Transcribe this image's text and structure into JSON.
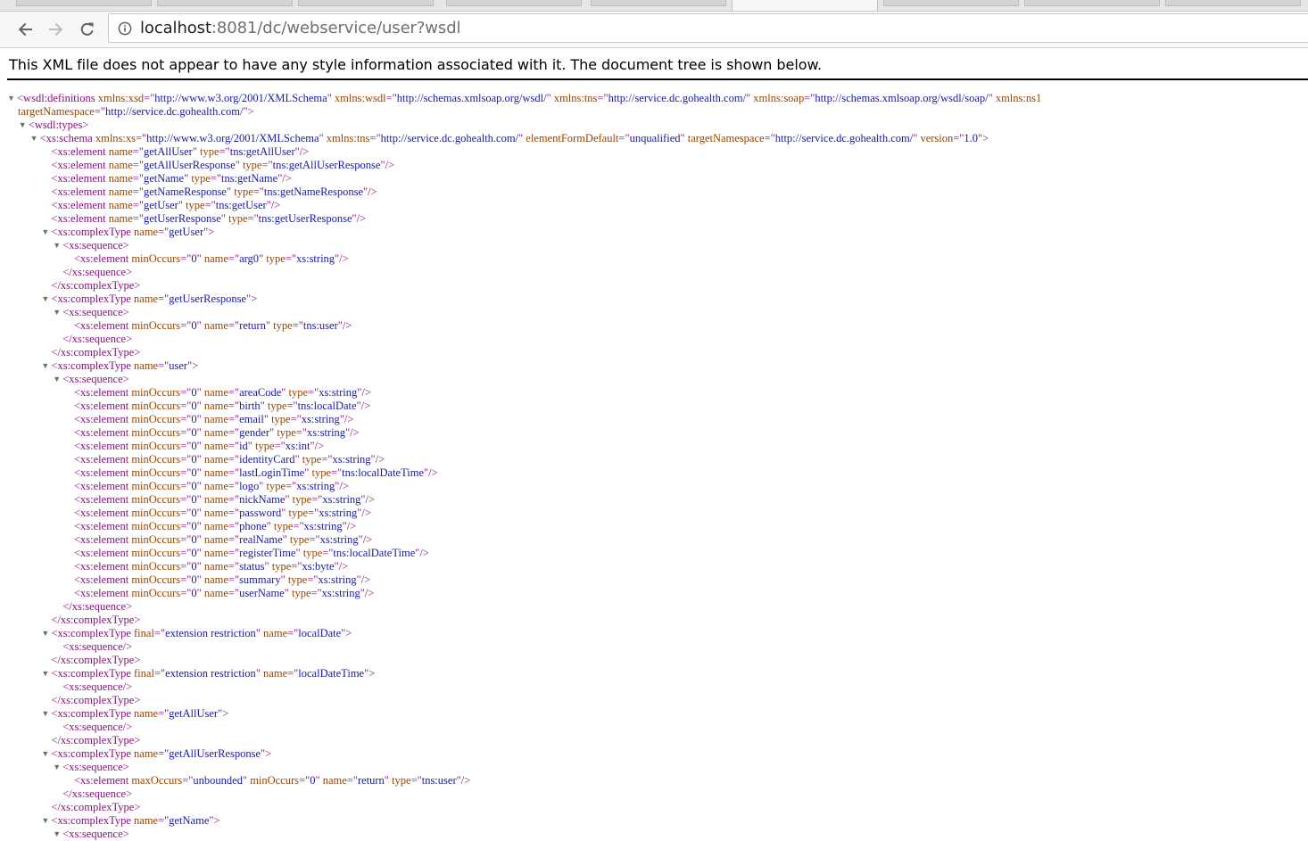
{
  "browser": {
    "address": {
      "host": "localhost",
      "rest": ":8081/dc/webservice/user?wsdl"
    },
    "icons": [
      "back-arrow-icon",
      "forward-arrow-icon",
      "reload-icon",
      "info-icon"
    ]
  },
  "notice": "This XML file does not appear to have any style information associated with it. The document tree is shown below.",
  "colors": {
    "tag": "#881280",
    "attr_name": "#994500",
    "attr_value": "#1a1aa6",
    "triangle": "#6e6e6e"
  },
  "xml_lines": [
    {
      "i": 0,
      "t": "open",
      "n": "wsdl:definitions",
      "a": [
        [
          "xmlns:xsd",
          "http://www.w3.org/2001/XMLSchema"
        ],
        [
          "xmlns:wsdl",
          "http://schemas.xmlsoap.org/wsdl/"
        ],
        [
          "xmlns:tns",
          "http://service.dc.gohealth.com/"
        ],
        [
          "xmlns:soap",
          "http://schemas.xmlsoap.org/wsdl/soap/"
        ]
      ],
      "extra": " xmlns:ns1",
      "tri": true
    },
    {
      "i": 0,
      "t": "raw",
      "a": [
        [
          "targetNamespace",
          "http://service.dc.gohealth.com/"
        ]
      ],
      "suffix": ">"
    },
    {
      "i": 1,
      "t": "open",
      "n": "wsdl:types",
      "a": [],
      "tri": true
    },
    {
      "i": 2,
      "t": "open",
      "n": "xs:schema",
      "a": [
        [
          "xmlns:xs",
          "http://www.w3.org/2001/XMLSchema"
        ],
        [
          "xmlns:tns",
          "http://service.dc.gohealth.com/"
        ],
        [
          "elementFormDefault",
          "unqualified"
        ],
        [
          "targetNamespace",
          "http://service.dc.gohealth.com/"
        ],
        [
          "version",
          "1.0"
        ]
      ],
      "tri": true
    },
    {
      "i": 3,
      "t": "self",
      "n": "xs:element",
      "a": [
        [
          "name",
          "getAllUser"
        ],
        [
          "type",
          "tns:getAllUser"
        ]
      ]
    },
    {
      "i": 3,
      "t": "self",
      "n": "xs:element",
      "a": [
        [
          "name",
          "getAllUserResponse"
        ],
        [
          "type",
          "tns:getAllUserResponse"
        ]
      ]
    },
    {
      "i": 3,
      "t": "self",
      "n": "xs:element",
      "a": [
        [
          "name",
          "getName"
        ],
        [
          "type",
          "tns:getName"
        ]
      ]
    },
    {
      "i": 3,
      "t": "self",
      "n": "xs:element",
      "a": [
        [
          "name",
          "getNameResponse"
        ],
        [
          "type",
          "tns:getNameResponse"
        ]
      ]
    },
    {
      "i": 3,
      "t": "self",
      "n": "xs:element",
      "a": [
        [
          "name",
          "getUser"
        ],
        [
          "type",
          "tns:getUser"
        ]
      ]
    },
    {
      "i": 3,
      "t": "self",
      "n": "xs:element",
      "a": [
        [
          "name",
          "getUserResponse"
        ],
        [
          "type",
          "tns:getUserResponse"
        ]
      ]
    },
    {
      "i": 3,
      "t": "open",
      "n": "xs:complexType",
      "a": [
        [
          "name",
          "getUser"
        ]
      ],
      "tri": true
    },
    {
      "i": 4,
      "t": "open",
      "n": "xs:sequence",
      "a": [],
      "tri": true
    },
    {
      "i": 5,
      "t": "self",
      "n": "xs:element",
      "a": [
        [
          "minOccurs",
          "0"
        ],
        [
          "name",
          "arg0"
        ],
        [
          "type",
          "xs:string"
        ]
      ]
    },
    {
      "i": 4,
      "t": "close",
      "n": "xs:sequence"
    },
    {
      "i": 3,
      "t": "close",
      "n": "xs:complexType"
    },
    {
      "i": 3,
      "t": "open",
      "n": "xs:complexType",
      "a": [
        [
          "name",
          "getUserResponse"
        ]
      ],
      "tri": true
    },
    {
      "i": 4,
      "t": "open",
      "n": "xs:sequence",
      "a": [],
      "tri": true
    },
    {
      "i": 5,
      "t": "self",
      "n": "xs:element",
      "a": [
        [
          "minOccurs",
          "0"
        ],
        [
          "name",
          "return"
        ],
        [
          "type",
          "tns:user"
        ]
      ]
    },
    {
      "i": 4,
      "t": "close",
      "n": "xs:sequence"
    },
    {
      "i": 3,
      "t": "close",
      "n": "xs:complexType"
    },
    {
      "i": 3,
      "t": "open",
      "n": "xs:complexType",
      "a": [
        [
          "name",
          "user"
        ]
      ],
      "tri": true
    },
    {
      "i": 4,
      "t": "open",
      "n": "xs:sequence",
      "a": [],
      "tri": true
    },
    {
      "i": 5,
      "t": "self",
      "n": "xs:element",
      "a": [
        [
          "minOccurs",
          "0"
        ],
        [
          "name",
          "areaCode"
        ],
        [
          "type",
          "xs:string"
        ]
      ]
    },
    {
      "i": 5,
      "t": "self",
      "n": "xs:element",
      "a": [
        [
          "minOccurs",
          "0"
        ],
        [
          "name",
          "birth"
        ],
        [
          "type",
          "tns:localDate"
        ]
      ]
    },
    {
      "i": 5,
      "t": "self",
      "n": "xs:element",
      "a": [
        [
          "minOccurs",
          "0"
        ],
        [
          "name",
          "email"
        ],
        [
          "type",
          "xs:string"
        ]
      ]
    },
    {
      "i": 5,
      "t": "self",
      "n": "xs:element",
      "a": [
        [
          "minOccurs",
          "0"
        ],
        [
          "name",
          "gender"
        ],
        [
          "type",
          "xs:string"
        ]
      ]
    },
    {
      "i": 5,
      "t": "self",
      "n": "xs:element",
      "a": [
        [
          "minOccurs",
          "0"
        ],
        [
          "name",
          "id"
        ],
        [
          "type",
          "xs:int"
        ]
      ]
    },
    {
      "i": 5,
      "t": "self",
      "n": "xs:element",
      "a": [
        [
          "minOccurs",
          "0"
        ],
        [
          "name",
          "identityCard"
        ],
        [
          "type",
          "xs:string"
        ]
      ]
    },
    {
      "i": 5,
      "t": "self",
      "n": "xs:element",
      "a": [
        [
          "minOccurs",
          "0"
        ],
        [
          "name",
          "lastLoginTime"
        ],
        [
          "type",
          "tns:localDateTime"
        ]
      ]
    },
    {
      "i": 5,
      "t": "self",
      "n": "xs:element",
      "a": [
        [
          "minOccurs",
          "0"
        ],
        [
          "name",
          "logo"
        ],
        [
          "type",
          "xs:string"
        ]
      ]
    },
    {
      "i": 5,
      "t": "self",
      "n": "xs:element",
      "a": [
        [
          "minOccurs",
          "0"
        ],
        [
          "name",
          "nickName"
        ],
        [
          "type",
          "xs:string"
        ]
      ]
    },
    {
      "i": 5,
      "t": "self",
      "n": "xs:element",
      "a": [
        [
          "minOccurs",
          "0"
        ],
        [
          "name",
          "password"
        ],
        [
          "type",
          "xs:string"
        ]
      ]
    },
    {
      "i": 5,
      "t": "self",
      "n": "xs:element",
      "a": [
        [
          "minOccurs",
          "0"
        ],
        [
          "name",
          "phone"
        ],
        [
          "type",
          "xs:string"
        ]
      ]
    },
    {
      "i": 5,
      "t": "self",
      "n": "xs:element",
      "a": [
        [
          "minOccurs",
          "0"
        ],
        [
          "name",
          "realName"
        ],
        [
          "type",
          "xs:string"
        ]
      ]
    },
    {
      "i": 5,
      "t": "self",
      "n": "xs:element",
      "a": [
        [
          "minOccurs",
          "0"
        ],
        [
          "name",
          "registerTime"
        ],
        [
          "type",
          "tns:localDateTime"
        ]
      ]
    },
    {
      "i": 5,
      "t": "self",
      "n": "xs:element",
      "a": [
        [
          "minOccurs",
          "0"
        ],
        [
          "name",
          "status"
        ],
        [
          "type",
          "xs:byte"
        ]
      ]
    },
    {
      "i": 5,
      "t": "self",
      "n": "xs:element",
      "a": [
        [
          "minOccurs",
          "0"
        ],
        [
          "name",
          "summary"
        ],
        [
          "type",
          "xs:string"
        ]
      ]
    },
    {
      "i": 5,
      "t": "self",
      "n": "xs:element",
      "a": [
        [
          "minOccurs",
          "0"
        ],
        [
          "name",
          "userName"
        ],
        [
          "type",
          "xs:string"
        ]
      ]
    },
    {
      "i": 4,
      "t": "close",
      "n": "xs:sequence"
    },
    {
      "i": 3,
      "t": "close",
      "n": "xs:complexType"
    },
    {
      "i": 3,
      "t": "open",
      "n": "xs:complexType",
      "a": [
        [
          "final",
          "extension restriction"
        ],
        [
          "name",
          "localDate"
        ]
      ],
      "tri": true
    },
    {
      "i": 4,
      "t": "self",
      "n": "xs:sequence",
      "a": []
    },
    {
      "i": 3,
      "t": "close",
      "n": "xs:complexType"
    },
    {
      "i": 3,
      "t": "open",
      "n": "xs:complexType",
      "a": [
        [
          "final",
          "extension restriction"
        ],
        [
          "name",
          "localDateTime"
        ]
      ],
      "tri": true
    },
    {
      "i": 4,
      "t": "self",
      "n": "xs:sequence",
      "a": []
    },
    {
      "i": 3,
      "t": "close",
      "n": "xs:complexType"
    },
    {
      "i": 3,
      "t": "open",
      "n": "xs:complexType",
      "a": [
        [
          "name",
          "getAllUser"
        ]
      ],
      "tri": true
    },
    {
      "i": 4,
      "t": "self",
      "n": "xs:sequence",
      "a": []
    },
    {
      "i": 3,
      "t": "close",
      "n": "xs:complexType"
    },
    {
      "i": 3,
      "t": "open",
      "n": "xs:complexType",
      "a": [
        [
          "name",
          "getAllUserResponse"
        ]
      ],
      "tri": true
    },
    {
      "i": 4,
      "t": "open",
      "n": "xs:sequence",
      "a": [],
      "tri": true
    },
    {
      "i": 5,
      "t": "self",
      "n": "xs:element",
      "a": [
        [
          "maxOccurs",
          "unbounded"
        ],
        [
          "minOccurs",
          "0"
        ],
        [
          "name",
          "return"
        ],
        [
          "type",
          "tns:user"
        ]
      ]
    },
    {
      "i": 4,
      "t": "close",
      "n": "xs:sequence"
    },
    {
      "i": 3,
      "t": "close",
      "n": "xs:complexType"
    },
    {
      "i": 3,
      "t": "open",
      "n": "xs:complexType",
      "a": [
        [
          "name",
          "getName"
        ]
      ],
      "tri": true
    },
    {
      "i": 4,
      "t": "open",
      "n": "xs:sequence",
      "a": [],
      "tri": true
    }
  ]
}
